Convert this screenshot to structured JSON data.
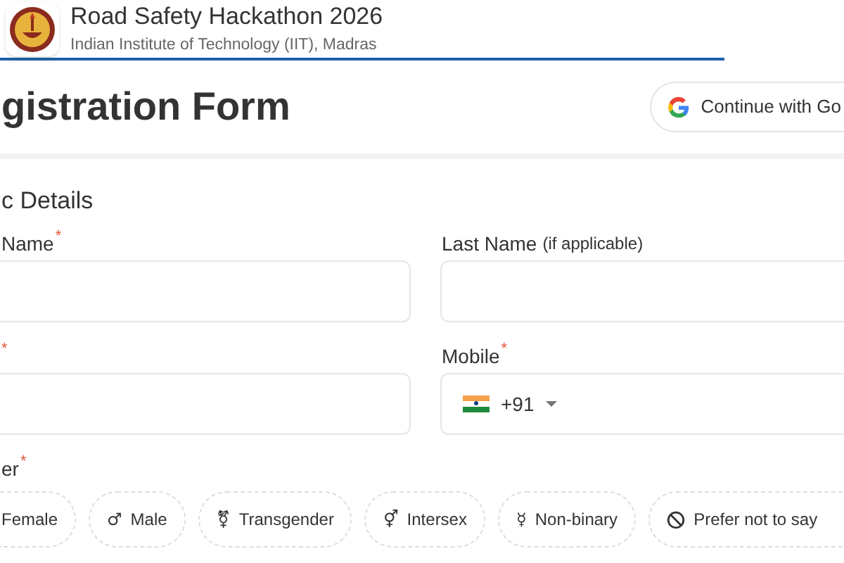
{
  "header": {
    "title": "Road Safety Hackathon 2026",
    "subtitle": "Indian Institute of Technology (IIT), Madras"
  },
  "page_title": "gistration Form",
  "google_button": {
    "label": "Continue with Go"
  },
  "section": {
    "title": "c Details"
  },
  "fields": [
    {
      "label": "Name",
      "required_mark": "*",
      "kind": "text"
    },
    {
      "label": "Last Name",
      "hint": "(if applicable)",
      "kind": "text"
    },
    {
      "required_mark": "*",
      "kind": "text"
    },
    {
      "label": "Mobile",
      "required_mark": "*",
      "kind": "phone",
      "code": "+91"
    }
  ],
  "gender": {
    "label": "er",
    "required_mark": "*",
    "options": [
      {
        "label": "Female",
        "kind": "plain",
        "selected": false
      },
      {
        "label": "Male",
        "kind": "symbol",
        "symbol": "♂",
        "selected": false
      },
      {
        "label": "Transgender",
        "kind": "symbol",
        "symbol": "⚧",
        "selected": false
      },
      {
        "label": "Intersex",
        "kind": "symbol",
        "symbol": "⚥",
        "selected": false
      },
      {
        "label": "Non-binary",
        "kind": "symbol",
        "symbol": "☿",
        "selected": false
      },
      {
        "label": "Prefer not to say",
        "kind": "none",
        "selected": false
      }
    ]
  }
}
